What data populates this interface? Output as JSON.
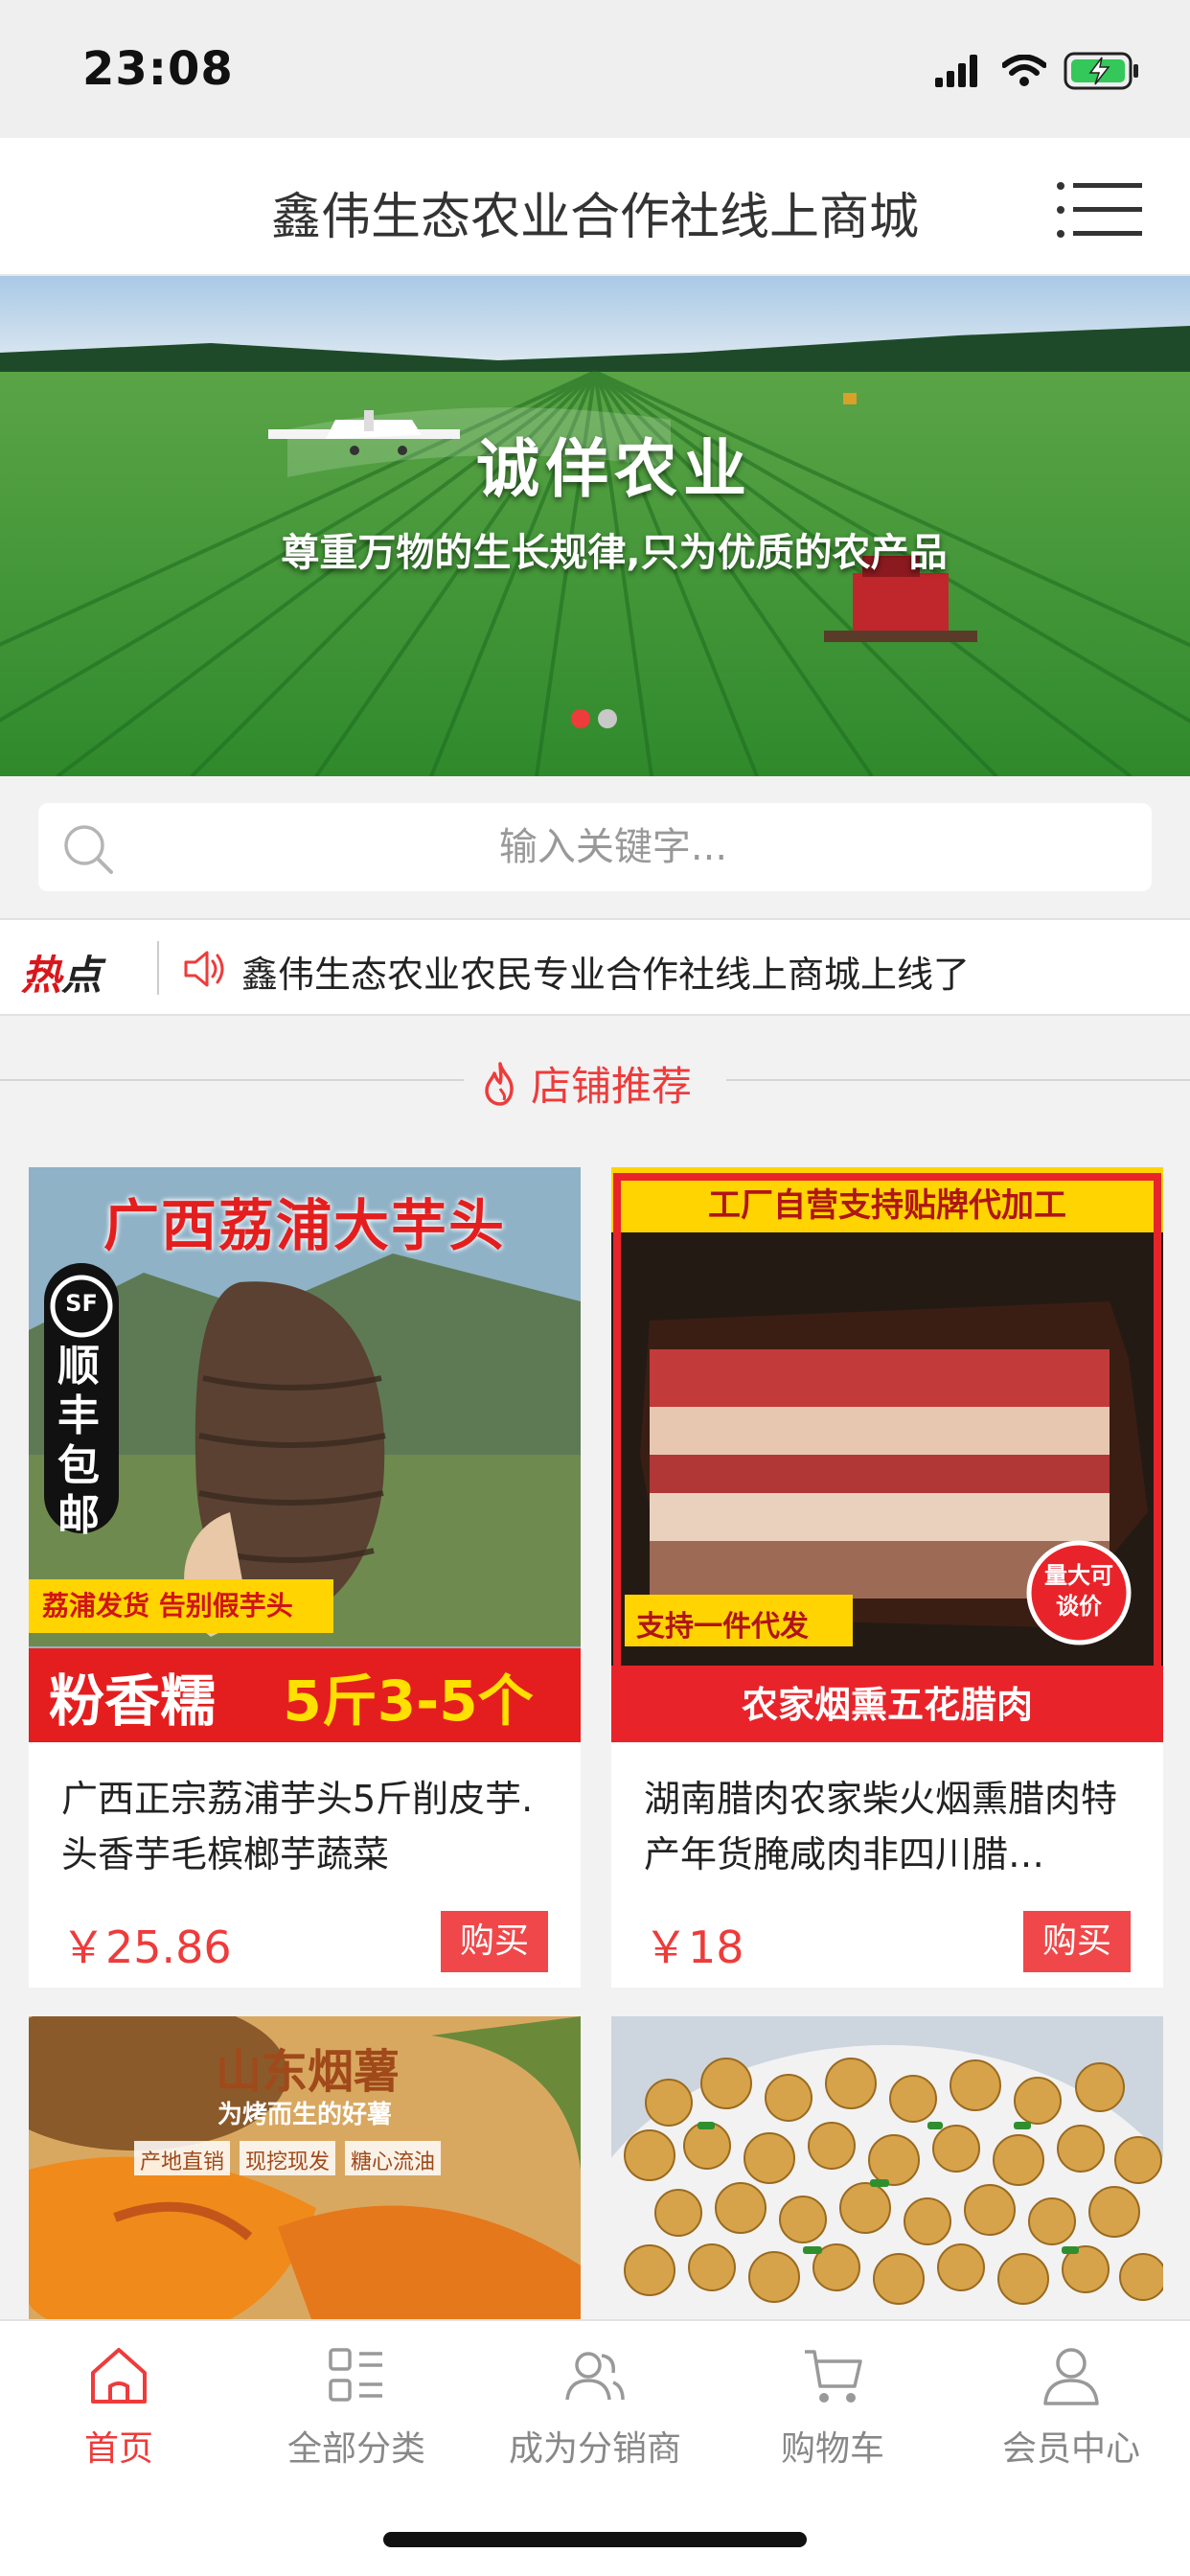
{
  "status": {
    "time": "23:08"
  },
  "header": {
    "title": "鑫伟生态农业合作社线上商城"
  },
  "banner": {
    "title": "诚佯农业",
    "subtitle": "尊重万物的生长规律,只为优质的农产品",
    "slide_count": 2,
    "active_slide": 1
  },
  "search": {
    "placeholder": "输入关键字..."
  },
  "hot": {
    "label_red": "热",
    "label_dark": "点",
    "text": "鑫伟生态农业农民专业合作社线上商城上线了"
  },
  "section": {
    "title": "店铺推荐"
  },
  "products": [
    {
      "name": "广西正宗荔浦芋头5斤削皮芋.头香芋毛槟榔芋蔬菜",
      "price": "￥25.86",
      "buy_label": "购买",
      "img_top_text": "广西荔浦大芋头",
      "img_badge_text": "顺丰包邮",
      "img_badge_logo": "SF",
      "img_tag_text": "荔浦发货 告别假芋头",
      "img_bottom_left": "粉香糯",
      "img_bottom_right": "5斤3-5个"
    },
    {
      "name": "湖南腊肉农家柴火烟熏腊肉特产年货腌咸肉非四川腊…",
      "price": "￥18",
      "buy_label": "购买",
      "img_top_text": "工厂自营支持贴牌代加工",
      "img_tag_text": "支持一件代发",
      "img_round_badge": "量大可谈价",
      "img_bottom_text": "农家烟熏五花腊肉"
    },
    {
      "img_title": "山东烟薯",
      "img_subtitle": "为烤而生的好薯",
      "img_tags": [
        "产地直销",
        "现挖现发",
        "糖心流油"
      ]
    },
    {}
  ],
  "tabs": [
    {
      "label": "首页",
      "icon": "home-icon",
      "active": true
    },
    {
      "label": "全部分类",
      "icon": "category-icon",
      "active": false
    },
    {
      "label": "成为分销商",
      "icon": "users-icon",
      "active": false
    },
    {
      "label": "购物车",
      "icon": "cart-icon",
      "active": false
    },
    {
      "label": "会员中心",
      "icon": "user-icon",
      "active": false
    }
  ],
  "colors": {
    "accent": "#ee3b3b",
    "buy_button": "#f0484a",
    "hot_red": "#d9161c"
  }
}
